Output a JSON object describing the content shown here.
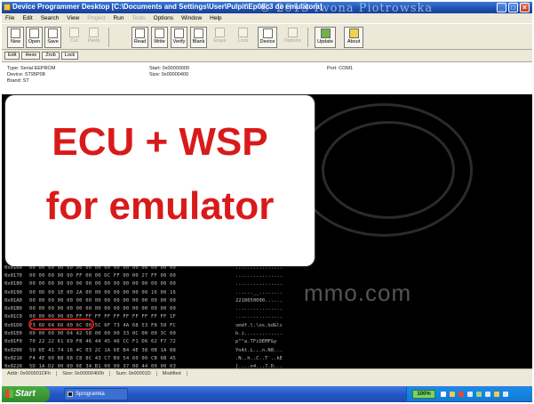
{
  "window": {
    "title": "Device Programmer Desktop  [C:\\Documents and Settings\\User\\Pulpit\\Ep08c3 do emulatora]",
    "watermark": "© 2013 Iwona Piotrowska"
  },
  "menu": {
    "items": [
      {
        "label": "File",
        "enabled": true
      },
      {
        "label": "Edit",
        "enabled": true
      },
      {
        "label": "Search",
        "enabled": true
      },
      {
        "label": "View",
        "enabled": true
      },
      {
        "label": "Project",
        "enabled": false
      },
      {
        "label": "Run",
        "enabled": true
      },
      {
        "label": "Tools",
        "enabled": false
      },
      {
        "label": "Options",
        "enabled": true
      },
      {
        "label": "Window",
        "enabled": true
      },
      {
        "label": "Help",
        "enabled": true
      }
    ]
  },
  "toolbar": {
    "new": "New",
    "open": "Open",
    "save": "Save",
    "cut": "Cut",
    "paste": "Paste",
    "read": "Read",
    "write": "Write",
    "verify": "Verify",
    "blank": "Blank",
    "erase": "Erase",
    "lock": "Lock",
    "device": "Device",
    "options": "Options",
    "update": "Update",
    "about": "About"
  },
  "subtabs": [
    "Edit",
    "Hexe",
    "Zrob",
    "Lock"
  ],
  "device_info": {
    "type": "Type: Serial EEPROM",
    "device": "Device: ST95P08",
    "brand": "Brand: ST",
    "start": "Start: 0x00000000",
    "size": "Size: 0x00000400",
    "port": "Port: COM1"
  },
  "overlay": {
    "line1": "ECU + WSP",
    "line2": "for emulator"
  },
  "site_watermark": "mmo.com",
  "hex_rows": [
    {
      "addr": "0x0160",
      "bytes": "00 00 00 00 00 00 00 00 00 00 00 00 00 00 00 00",
      "ascii": "................"
    },
    {
      "addr": "0x0170",
      "bytes": "00 00 00 00 00 FF 00 00 DC FF 00 00 27 FF 00 00",
      "ascii": "................"
    },
    {
      "addr": "0x0180",
      "bytes": "00 00 00 00 00 00 00 00 00 00 00 00 00 00 00 00",
      "ascii": "................"
    },
    {
      "addr": "0x0190",
      "bytes": "00 0D 00 1E 00 2A 00 00 00 00 00 00 00 16 00 16",
      "ascii": "......__........"
    },
    {
      "addr": "0x01A0",
      "bytes": "00 00 00 00 00 00 00 00 00 00 00 00 00 00 00 00",
      "ascii": "2218650000......"
    },
    {
      "addr": "0x01B0",
      "bytes": "00 00 00 00 00 00 00 00 00 00 00 00 00 00 00 00",
      "ascii": "................"
    },
    {
      "addr": "0x01C0",
      "bytes": "00 00 00 00 00 FF FF FF FF FF FF FF FF FF FF 1F",
      "ascii": "................"
    },
    {
      "addr": "0x01D0",
      "bytes": "73 6D 64 66 00 6C 00 5C 6F 73 4A 68 53 F8 58 FC",
      "ascii": "smdf.l.\\os.bd&lc"
    },
    {
      "addr": "0x01E0",
      "bytes": "00 00 00 00 04 42 58 00 00 00 33 0C 00 00 3C 00",
      "ascii": "b.i............."
    },
    {
      "addr": "0x01F0",
      "bytes": "70 22 22 61 69 F8 46 44 45 46 CC F1 D6 62 F7 72",
      "ascii": "p\"\"a.TFiDEMF&y"
    },
    {
      "addr": "0x0200",
      "bytes": "59 6E 41 74 16 4C 03 2C 1A 6E B4 4E 38 0B 1A 88",
      "ascii": "YnAt.L.,.n.N8..."
    },
    {
      "addr": "0x0210",
      "bytes": "F4 4E 00 B8 68 C8 8C 43 C7 B9 54 60 00 CB 6B 45",
      "ascii": ".N..h..C..T`..kE"
    },
    {
      "addr": "0x0220",
      "bytes": "5D 1A D2 00 00 6E 34 B1 00 00 37 00 44 00 00 03",
      "ascii": "]....n4...7.D..."
    }
  ],
  "status": {
    "addr": "Addr: 0x000001DFh",
    "size": "Size: 0x00000400h",
    "sum": "Sum: 0x00001D",
    "state": "Modified"
  },
  "taskbar": {
    "start": "Start",
    "task": "Sprogramka",
    "zoom": "100%"
  }
}
